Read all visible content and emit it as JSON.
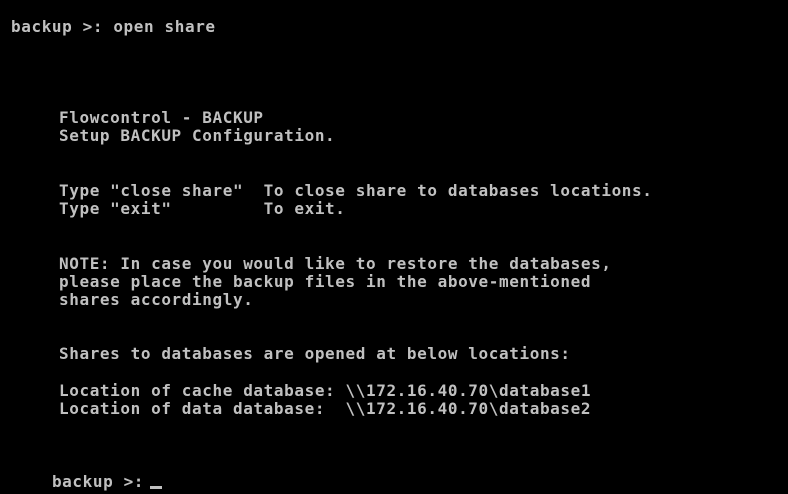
{
  "console": {
    "prompt_top": "backup >: open share",
    "header_line1": "Flowcontrol - BACKUP",
    "header_line2": "Setup BACKUP Configuration.",
    "help_line1": "Type \"close share\"  To close share to databases locations.",
    "help_line2": "Type \"exit\"         To exit.",
    "note_line1": "NOTE: In case you would like to restore the databases,",
    "note_line2": "please place the backup files in the above-mentioned",
    "note_line3": "shares accordingly.",
    "shares_heading": "Shares to databases are opened at below locations:",
    "location_cache": "Location of cache database: \\\\172.16.40.70\\database1",
    "location_data": "Location of data database:  \\\\172.16.40.70\\database2",
    "prompt_bottom": "backup >:"
  },
  "colors": {
    "background": "#000000",
    "text": "#c0c0c0"
  }
}
